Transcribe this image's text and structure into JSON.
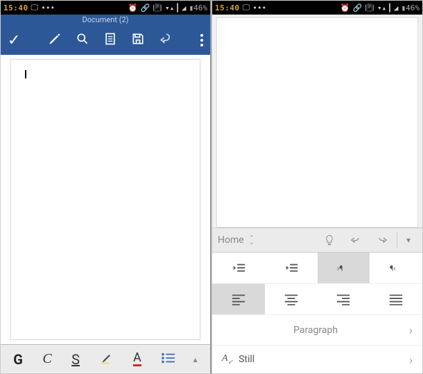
{
  "status": {
    "time": "15:40",
    "battery": "46%"
  },
  "left": {
    "doc_title": "Document (2)",
    "bottom": {
      "bold": "G",
      "italic": "C",
      "underline": "S",
      "font_color": "A"
    }
  },
  "right": {
    "home_bar": {
      "label": "Home"
    },
    "sections": {
      "paragraph": "Paragraph",
      "still": "Still"
    }
  }
}
